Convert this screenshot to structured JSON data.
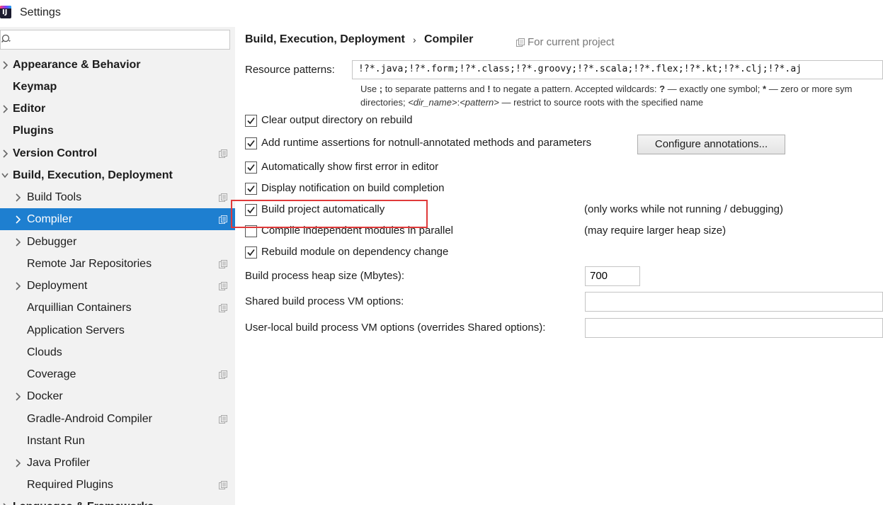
{
  "window": {
    "title": "Settings",
    "app_icon_letters": "IJ"
  },
  "search": {
    "placeholder": "",
    "value": ""
  },
  "sidebar": {
    "items": [
      {
        "label": "Appearance & Behavior",
        "chevron": true
      },
      {
        "label": "Keymap",
        "chevron": false
      },
      {
        "label": "Editor",
        "chevron": true
      },
      {
        "label": "Plugins",
        "chevron": false
      },
      {
        "label": "Version Control",
        "chevron": true,
        "project_icon": true
      },
      {
        "label": "Build, Execution, Deployment",
        "chevron": "expanded"
      },
      {
        "label": "Build Tools",
        "chevron": true,
        "project_icon": true
      },
      {
        "label": "Compiler",
        "chevron": true,
        "project_icon": true,
        "selected": true
      },
      {
        "label": "Debugger",
        "chevron": true
      },
      {
        "label": "Remote Jar Repositories",
        "chevron": false,
        "project_icon": true
      },
      {
        "label": "Deployment",
        "chevron": true,
        "project_icon": true
      },
      {
        "label": "Arquillian Containers",
        "chevron": false,
        "project_icon": true
      },
      {
        "label": "Application Servers",
        "chevron": false
      },
      {
        "label": "Clouds",
        "chevron": false
      },
      {
        "label": "Coverage",
        "chevron": false,
        "project_icon": true
      },
      {
        "label": "Docker",
        "chevron": true
      },
      {
        "label": "Gradle-Android Compiler",
        "chevron": false,
        "project_icon": true
      },
      {
        "label": "Instant Run",
        "chevron": false
      },
      {
        "label": "Java Profiler",
        "chevron": true
      },
      {
        "label": "Required Plugins",
        "chevron": false,
        "project_icon": true
      },
      {
        "label": "Languages & Frameworks",
        "chevron": true
      }
    ]
  },
  "breadcrumb": {
    "parent": "Build, Execution, Deployment",
    "separator": "›",
    "current": "Compiler",
    "scope": "For current project"
  },
  "resource_patterns": {
    "label": "Resource patterns:",
    "value": "!?*.java;!?*.form;!?*.class;!?*.groovy;!?*.scala;!?*.flex;!?*.kt;!?*.clj;!?*.aj",
    "hint_line1_parts": [
      "Use ",
      ";",
      " to separate patterns and ",
      "!",
      " to negate a pattern. Accepted wildcards: ",
      "?",
      " — exactly one symbol; ",
      "*",
      " — zero or more sym"
    ],
    "hint_line2_parts": [
      "directories; ",
      "<dir_name>",
      ":",
      "<pattern>",
      " — restrict to source roots with the specified name"
    ]
  },
  "options": [
    {
      "label": "Clear output directory on rebuild",
      "checked": true,
      "note": ""
    },
    {
      "label": "Add runtime assertions for notnull-annotated methods and parameters",
      "checked": true,
      "note": ""
    },
    {
      "label": "Automatically show first error in editor",
      "checked": true,
      "note": ""
    },
    {
      "label": "Display notification on build completion",
      "checked": true,
      "note": ""
    },
    {
      "label": "Build project automatically",
      "checked": true,
      "note": "(only works while not running / debugging)"
    },
    {
      "label": "Compile independent modules in parallel",
      "checked": false,
      "note": "(may require larger heap size)"
    },
    {
      "label": "Rebuild module on dependency change",
      "checked": true,
      "note": ""
    }
  ],
  "configure_button": "Configure annotations...",
  "heap": {
    "label": "Build process heap size (Mbytes):",
    "value": "700"
  },
  "shared_vm": {
    "label": "Shared build process VM options:",
    "value": ""
  },
  "user_vm": {
    "label": "User-local build process VM options (overrides Shared options):",
    "value": ""
  },
  "colors": {
    "selection": "#1e7fd0",
    "highlight_box": "#e03a3a",
    "sidebar_bg": "#f2f2f2"
  }
}
